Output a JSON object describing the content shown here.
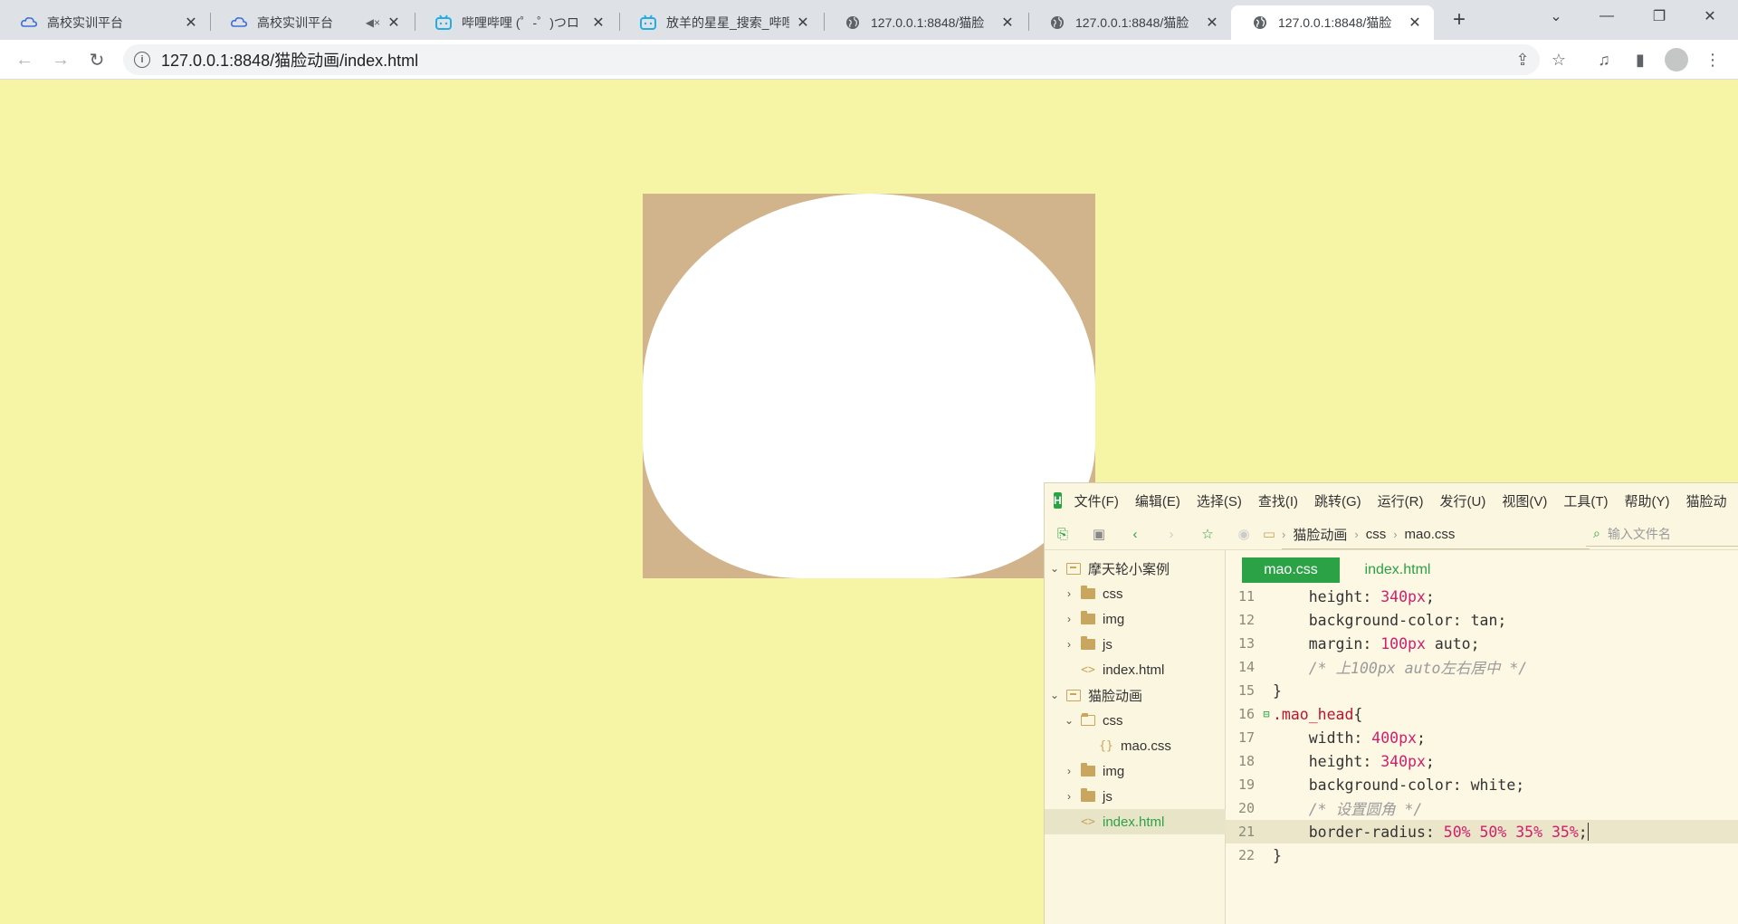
{
  "browser": {
    "tabs": [
      {
        "title": "高校实训平台",
        "icon": "cloud-icon"
      },
      {
        "title": "高校实训平台",
        "icon": "cloud-icon",
        "muted": "◀×"
      },
      {
        "title": "哔哩哔哩 (゜-゜)つロ",
        "icon": "bilibili-icon"
      },
      {
        "title": "放羊的星星_搜索_哔哩",
        "icon": "bilibili-icon"
      },
      {
        "title": "127.0.0.1:8848/猫脸",
        "icon": "globe-icon"
      },
      {
        "title": "127.0.0.1:8848/猫脸",
        "icon": "globe-icon"
      },
      {
        "title": "127.0.0.1:8848/猫脸",
        "icon": "globe-icon",
        "active": true
      }
    ],
    "url": "127.0.0.1:8848/猫脸动画/index.html"
  },
  "page": {
    "box_color": "#d2b48c",
    "head_color": "#ffffff",
    "background": "#f5f5a5"
  },
  "editor": {
    "menu": [
      "文件(F)",
      "编辑(E)",
      "选择(S)",
      "查找(I)",
      "跳转(G)",
      "运行(R)",
      "发行(U)",
      "视图(V)",
      "工具(T)",
      "帮助(Y)",
      "猫脸动"
    ],
    "breadcrumb": [
      "猫脸动画",
      "css",
      "mao.css"
    ],
    "file_search_placeholder": "输入文件名",
    "tree": [
      {
        "label": "摩天轮小案例",
        "level": 0,
        "chevron": "⌄",
        "type": "project"
      },
      {
        "label": "css",
        "level": 1,
        "chevron": "›",
        "type": "folder"
      },
      {
        "label": "img",
        "level": 1,
        "chevron": "›",
        "type": "folder"
      },
      {
        "label": "js",
        "level": 1,
        "chevron": "›",
        "type": "folder"
      },
      {
        "label": "index.html",
        "level": 1,
        "chevron": "",
        "type": "html"
      },
      {
        "label": "猫脸动画",
        "level": 0,
        "chevron": "⌄",
        "type": "project"
      },
      {
        "label": "css",
        "level": 1,
        "chevron": "⌄",
        "type": "folder-open"
      },
      {
        "label": "mao.css",
        "level": 2,
        "chevron": "",
        "type": "css"
      },
      {
        "label": "img",
        "level": 1,
        "chevron": "›",
        "type": "folder"
      },
      {
        "label": "js",
        "level": 1,
        "chevron": "›",
        "type": "folder"
      },
      {
        "label": "index.html",
        "level": 1,
        "chevron": "",
        "type": "html",
        "selected": true
      }
    ],
    "tabs": [
      {
        "label": "mao.css",
        "active": true
      },
      {
        "label": "index.html",
        "active": false
      }
    ],
    "code": [
      {
        "n": "11",
        "indent": "    ",
        "prop": "height",
        "num": "340px",
        "rest": ";"
      },
      {
        "n": "12",
        "indent": "    ",
        "prop": "background-color",
        "val": "tan",
        "rest": ";"
      },
      {
        "n": "13",
        "indent": "    ",
        "prop": "margin",
        "num": "100px",
        "val2": " auto",
        "rest": ";"
      },
      {
        "n": "14",
        "indent": "    ",
        "comment": "/* 上100px auto左右居中 */"
      },
      {
        "n": "15",
        "raw": "}"
      },
      {
        "n": "16",
        "selector": ".mao_head",
        "raw_after": "{",
        "fold": "⊟"
      },
      {
        "n": "17",
        "indent": "    ",
        "prop": "width",
        "num": "400px",
        "rest": ";"
      },
      {
        "n": "18",
        "indent": "    ",
        "prop": "height",
        "num": "340px",
        "rest": ";"
      },
      {
        "n": "19",
        "indent": "    ",
        "prop": "background-color",
        "val": "white",
        "rest": ";"
      },
      {
        "n": "20",
        "indent": "    ",
        "comment": "/* 设置圆角 */"
      },
      {
        "n": "21",
        "indent": "    ",
        "prop": "border-radius",
        "num": "50% 50% 35% 35%",
        "rest": ";",
        "current": true
      },
      {
        "n": "22",
        "raw": "}"
      }
    ]
  }
}
